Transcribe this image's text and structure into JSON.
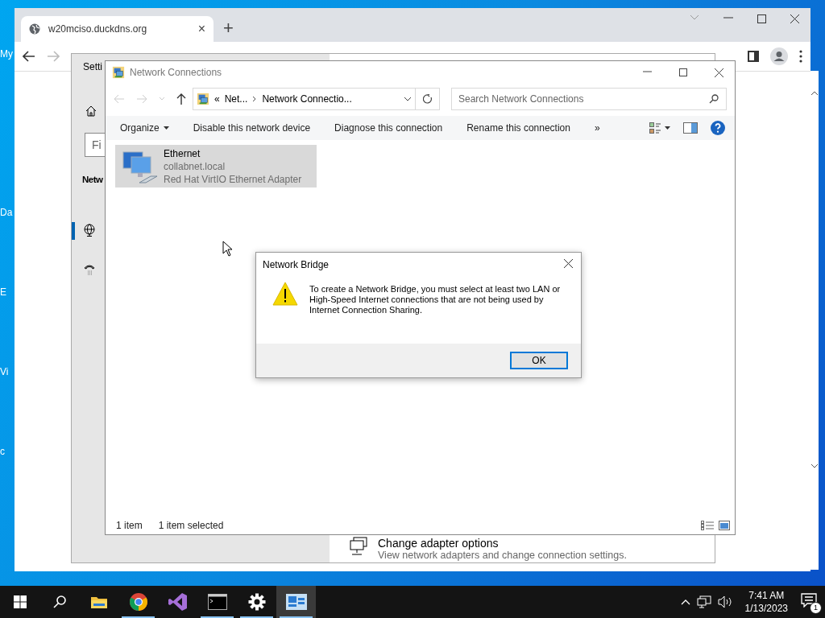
{
  "desktop_icons": [
    {
      "label": "My"
    },
    {
      "label": "Da"
    },
    {
      "label": "E"
    },
    {
      "label": "Vi"
    },
    {
      "label": "c"
    }
  ],
  "browser": {
    "tab": {
      "title": "w20mciso.duckdns.org",
      "close": "×"
    },
    "new_tab": "+"
  },
  "settings": {
    "title": "Setti",
    "search": {
      "placeholder": "Fi"
    },
    "heading": "Netw",
    "nav": [
      {
        "kind": "globe",
        "selected": true
      },
      {
        "kind": "dialup",
        "selected": false
      }
    ],
    "link": {
      "title": "Change adapter options",
      "description": "View network adapters and change connection settings."
    }
  },
  "network_connections": {
    "window": {
      "title": "Network Connections"
    },
    "address": {
      "overflow": "«",
      "crumbs": [
        "Net...",
        "Network Connectio..."
      ]
    },
    "search": {
      "placeholder": "Search Network Connections"
    },
    "commands": [
      {
        "label": "Organize",
        "dropdown": true
      },
      {
        "label": "Disable this network device",
        "dropdown": false
      },
      {
        "label": "Diagnose this connection",
        "dropdown": false
      },
      {
        "label": "Rename this connection",
        "dropdown": false
      }
    ],
    "more": "»",
    "items": [
      {
        "name": "Ethernet",
        "network": "collabnet.local",
        "device": "Red Hat VirtIO Ethernet Adapter",
        "selected": true
      }
    ],
    "status_bar": {
      "count": "1 item",
      "selection": "1 item selected"
    }
  },
  "dialog": {
    "title": "Network Bridge",
    "message": "To create a Network Bridge, you must select at least two LAN or High-Speed Internet connections that are not being used by Internet Connection Sharing.",
    "button": "OK"
  },
  "taskbar": {
    "apps": [
      {
        "kind": "start",
        "running": false,
        "selected": false
      },
      {
        "kind": "search",
        "running": false,
        "selected": false
      },
      {
        "kind": "explorer",
        "running": false,
        "selected": false
      },
      {
        "kind": "chrome",
        "running": true,
        "selected": false
      },
      {
        "kind": "studio",
        "running": false,
        "selected": false
      },
      {
        "kind": "terminal",
        "running": true,
        "selected": false
      },
      {
        "kind": "settings",
        "running": true,
        "selected": false
      },
      {
        "kind": "network",
        "running": true,
        "selected": true
      }
    ],
    "time": "7:41 AM",
    "date": "1/13/2023",
    "notifications": "1"
  }
}
